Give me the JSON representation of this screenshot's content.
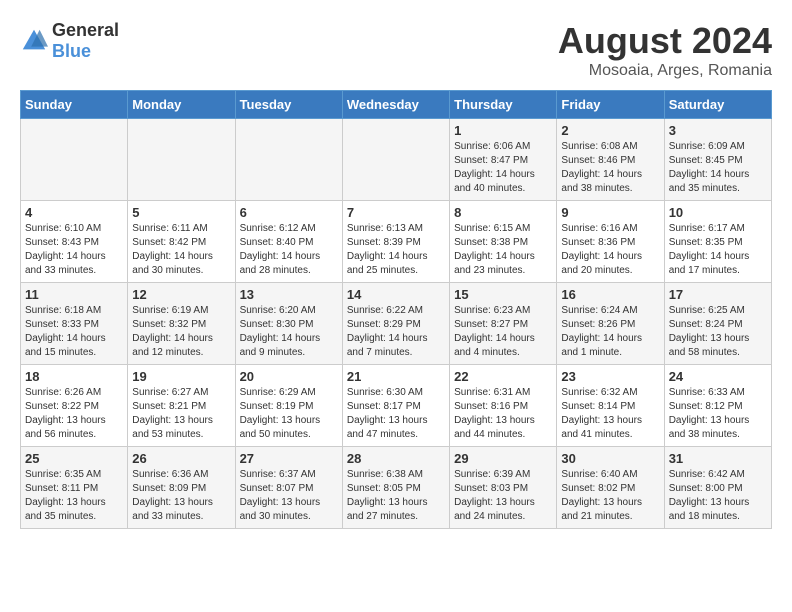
{
  "header": {
    "logo_general": "General",
    "logo_blue": "Blue",
    "main_title": "August 2024",
    "subtitle": "Mosoaia, Arges, Romania"
  },
  "weekdays": [
    "Sunday",
    "Monday",
    "Tuesday",
    "Wednesday",
    "Thursday",
    "Friday",
    "Saturday"
  ],
  "weeks": [
    [
      {
        "day": "",
        "text": ""
      },
      {
        "day": "",
        "text": ""
      },
      {
        "day": "",
        "text": ""
      },
      {
        "day": "",
        "text": ""
      },
      {
        "day": "1",
        "text": "Sunrise: 6:06 AM\nSunset: 8:47 PM\nDaylight: 14 hours and 40 minutes."
      },
      {
        "day": "2",
        "text": "Sunrise: 6:08 AM\nSunset: 8:46 PM\nDaylight: 14 hours and 38 minutes."
      },
      {
        "day": "3",
        "text": "Sunrise: 6:09 AM\nSunset: 8:45 PM\nDaylight: 14 hours and 35 minutes."
      }
    ],
    [
      {
        "day": "4",
        "text": "Sunrise: 6:10 AM\nSunset: 8:43 PM\nDaylight: 14 hours and 33 minutes."
      },
      {
        "day": "5",
        "text": "Sunrise: 6:11 AM\nSunset: 8:42 PM\nDaylight: 14 hours and 30 minutes."
      },
      {
        "day": "6",
        "text": "Sunrise: 6:12 AM\nSunset: 8:40 PM\nDaylight: 14 hours and 28 minutes."
      },
      {
        "day": "7",
        "text": "Sunrise: 6:13 AM\nSunset: 8:39 PM\nDaylight: 14 hours and 25 minutes."
      },
      {
        "day": "8",
        "text": "Sunrise: 6:15 AM\nSunset: 8:38 PM\nDaylight: 14 hours and 23 minutes."
      },
      {
        "day": "9",
        "text": "Sunrise: 6:16 AM\nSunset: 8:36 PM\nDaylight: 14 hours and 20 minutes."
      },
      {
        "day": "10",
        "text": "Sunrise: 6:17 AM\nSunset: 8:35 PM\nDaylight: 14 hours and 17 minutes."
      }
    ],
    [
      {
        "day": "11",
        "text": "Sunrise: 6:18 AM\nSunset: 8:33 PM\nDaylight: 14 hours and 15 minutes."
      },
      {
        "day": "12",
        "text": "Sunrise: 6:19 AM\nSunset: 8:32 PM\nDaylight: 14 hours and 12 minutes."
      },
      {
        "day": "13",
        "text": "Sunrise: 6:20 AM\nSunset: 8:30 PM\nDaylight: 14 hours and 9 minutes."
      },
      {
        "day": "14",
        "text": "Sunrise: 6:22 AM\nSunset: 8:29 PM\nDaylight: 14 hours and 7 minutes."
      },
      {
        "day": "15",
        "text": "Sunrise: 6:23 AM\nSunset: 8:27 PM\nDaylight: 14 hours and 4 minutes."
      },
      {
        "day": "16",
        "text": "Sunrise: 6:24 AM\nSunset: 8:26 PM\nDaylight: 14 hours and 1 minute."
      },
      {
        "day": "17",
        "text": "Sunrise: 6:25 AM\nSunset: 8:24 PM\nDaylight: 13 hours and 58 minutes."
      }
    ],
    [
      {
        "day": "18",
        "text": "Sunrise: 6:26 AM\nSunset: 8:22 PM\nDaylight: 13 hours and 56 minutes."
      },
      {
        "day": "19",
        "text": "Sunrise: 6:27 AM\nSunset: 8:21 PM\nDaylight: 13 hours and 53 minutes."
      },
      {
        "day": "20",
        "text": "Sunrise: 6:29 AM\nSunset: 8:19 PM\nDaylight: 13 hours and 50 minutes."
      },
      {
        "day": "21",
        "text": "Sunrise: 6:30 AM\nSunset: 8:17 PM\nDaylight: 13 hours and 47 minutes."
      },
      {
        "day": "22",
        "text": "Sunrise: 6:31 AM\nSunset: 8:16 PM\nDaylight: 13 hours and 44 minutes."
      },
      {
        "day": "23",
        "text": "Sunrise: 6:32 AM\nSunset: 8:14 PM\nDaylight: 13 hours and 41 minutes."
      },
      {
        "day": "24",
        "text": "Sunrise: 6:33 AM\nSunset: 8:12 PM\nDaylight: 13 hours and 38 minutes."
      }
    ],
    [
      {
        "day": "25",
        "text": "Sunrise: 6:35 AM\nSunset: 8:11 PM\nDaylight: 13 hours and 35 minutes."
      },
      {
        "day": "26",
        "text": "Sunrise: 6:36 AM\nSunset: 8:09 PM\nDaylight: 13 hours and 33 minutes."
      },
      {
        "day": "27",
        "text": "Sunrise: 6:37 AM\nSunset: 8:07 PM\nDaylight: 13 hours and 30 minutes."
      },
      {
        "day": "28",
        "text": "Sunrise: 6:38 AM\nSunset: 8:05 PM\nDaylight: 13 hours and 27 minutes."
      },
      {
        "day": "29",
        "text": "Sunrise: 6:39 AM\nSunset: 8:03 PM\nDaylight: 13 hours and 24 minutes."
      },
      {
        "day": "30",
        "text": "Sunrise: 6:40 AM\nSunset: 8:02 PM\nDaylight: 13 hours and 21 minutes."
      },
      {
        "day": "31",
        "text": "Sunrise: 6:42 AM\nSunset: 8:00 PM\nDaylight: 13 hours and 18 minutes."
      }
    ]
  ]
}
